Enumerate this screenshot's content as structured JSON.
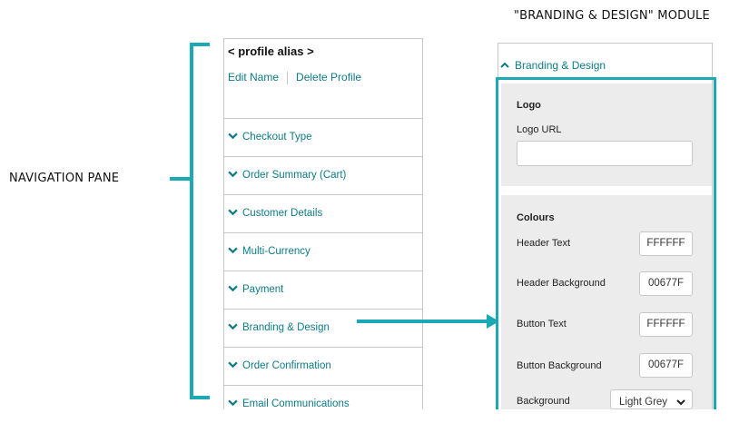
{
  "annotations": {
    "module_title": "\"BRANDING & DESIGN\" MODULE",
    "nav_pane_label": "NAVIGATION PANE"
  },
  "nav": {
    "profile_alias": "< profile alias >",
    "edit_name": "Edit Name",
    "delete_profile": "Delete Profile",
    "items": [
      {
        "label": "Checkout Type",
        "icon": "chevron-down-icon"
      },
      {
        "label": "Order Summary (Cart)",
        "icon": "chevron-down-icon"
      },
      {
        "label": "Customer Details",
        "icon": "chevron-down-icon"
      },
      {
        "label": "Multi-Currency",
        "icon": "chevron-down-icon"
      },
      {
        "label": "Payment",
        "icon": "chevron-down-icon"
      },
      {
        "label": "Branding & Design",
        "icon": "chevron-down-icon"
      },
      {
        "label": "Order Confirmation",
        "icon": "chevron-down-icon"
      },
      {
        "label": "Email Communications",
        "icon": "chevron-down-icon"
      }
    ]
  },
  "module": {
    "header": "Branding & Design",
    "header_icon": "chevron-up-icon",
    "logo": {
      "heading": "Logo",
      "url_label": "Logo URL",
      "url_value": ""
    },
    "colours": {
      "heading": "Colours",
      "fields": [
        {
          "label": "Header Text",
          "value": "FFFFFF"
        },
        {
          "label": "Header Background",
          "value": "00677F"
        },
        {
          "label": "Button Text",
          "value": "FFFFFF"
        },
        {
          "label": "Button Background",
          "value": "00677F"
        }
      ],
      "background": {
        "label": "Background",
        "value": "Light Grey"
      }
    }
  },
  "colors": {
    "accent": "#1aa9b5",
    "link": "#0d7b85",
    "panel": "#ececec"
  }
}
